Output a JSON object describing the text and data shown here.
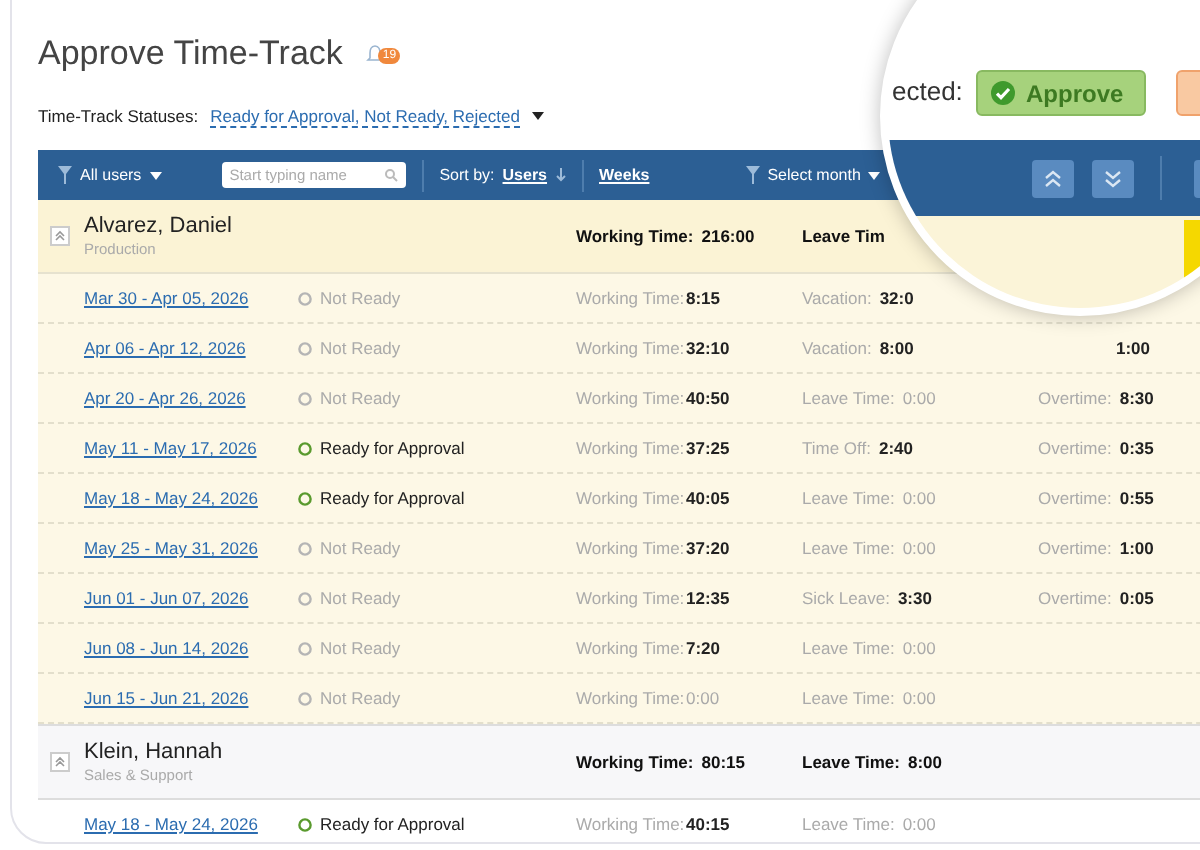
{
  "title": "Approve Time-Track",
  "notifications": {
    "count": "19"
  },
  "filter": {
    "label": "Time-Track Statuses:",
    "value": "Ready for Approval, Not Ready, Rejected"
  },
  "toolbar": {
    "users": "All users",
    "search": {
      "placeholder": "Start typing name"
    },
    "sort_label": "Sort by:",
    "sort_value": "Users",
    "period": "Weeks",
    "month": "Select month"
  },
  "magnifier": {
    "label": "ected:",
    "approve_button": "Approve"
  },
  "groups": [
    {
      "name": "Alvarez, Daniel",
      "department": "Production",
      "highlighted": true,
      "working": {
        "label": "Working Time:",
        "value": "216:00"
      },
      "leave": {
        "label": "Leave Tim"
      },
      "rows": [
        {
          "period": "Mar 30 - Apr 05, 2026",
          "status": {
            "kind": "not_ready",
            "label": "Not Ready"
          },
          "working": {
            "label": "Working Time:",
            "value": "8:15",
            "muted": false
          },
          "leave": {
            "label": "Vacation:",
            "value": "32:0",
            "muted": false
          }
        },
        {
          "period": "Apr 06 - Apr 12, 2026",
          "status": {
            "kind": "not_ready",
            "label": "Not Ready"
          },
          "working": {
            "label": "Working Time:",
            "value": "32:10",
            "muted": false
          },
          "leave": {
            "label": "Vacation:",
            "value": "8:00",
            "muted": false
          },
          "overtime": {
            "value": "1:00",
            "muted": false
          }
        },
        {
          "period": "Apr 20 - Apr 26, 2026",
          "status": {
            "kind": "not_ready",
            "label": "Not Ready"
          },
          "working": {
            "label": "Working Time:",
            "value": "40:50",
            "muted": false
          },
          "leave": {
            "label": "Leave Time:",
            "value": "0:00",
            "muted": true
          },
          "overtime": {
            "label": "Overtime:",
            "value": "8:30",
            "muted": false
          }
        },
        {
          "period": "May 11 - May 17, 2026",
          "status": {
            "kind": "ready",
            "label": "Ready for Approval"
          },
          "working": {
            "label": "Working Time:",
            "value": "37:25",
            "muted": false
          },
          "leave": {
            "label": "Time Off:",
            "value": "2:40",
            "muted": false
          },
          "overtime": {
            "label": "Overtime:",
            "value": "0:35",
            "muted": false
          }
        },
        {
          "period": "May 18 - May 24, 2026",
          "status": {
            "kind": "ready",
            "label": "Ready for Approval"
          },
          "working": {
            "label": "Working Time:",
            "value": "40:05",
            "muted": false
          },
          "leave": {
            "label": "Leave Time:",
            "value": "0:00",
            "muted": true
          },
          "overtime": {
            "label": "Overtime:",
            "value": "0:55",
            "muted": false
          }
        },
        {
          "period": "May 25 - May 31, 2026",
          "status": {
            "kind": "not_ready",
            "label": "Not Ready"
          },
          "working": {
            "label": "Working Time:",
            "value": "37:20",
            "muted": false
          },
          "leave": {
            "label": "Leave Time:",
            "value": "0:00",
            "muted": true
          },
          "overtime": {
            "label": "Overtime:",
            "value": "1:00",
            "muted": false
          }
        },
        {
          "period": "Jun 01 - Jun 07, 2026",
          "status": {
            "kind": "not_ready",
            "label": "Not Ready"
          },
          "working": {
            "label": "Working Time:",
            "value": "12:35",
            "muted": false
          },
          "leave": {
            "label": "Sick Leave:",
            "value": "3:30",
            "muted": false
          },
          "overtime": {
            "label": "Overtime:",
            "value": "0:05",
            "muted": false
          }
        },
        {
          "period": "Jun 08 - Jun 14, 2026",
          "status": {
            "kind": "not_ready",
            "label": "Not Ready"
          },
          "working": {
            "label": "Working Time:",
            "value": "7:20",
            "muted": false
          },
          "leave": {
            "label": "Leave Time:",
            "value": "0:00",
            "muted": true
          }
        },
        {
          "period": "Jun 15 - Jun 21, 2026",
          "status": {
            "kind": "not_ready",
            "label": "Not Ready"
          },
          "working": {
            "label": "Working Time:",
            "value": "0:00",
            "muted": true
          },
          "leave": {
            "label": "Leave Time:",
            "value": "0:00",
            "muted": true
          }
        }
      ]
    },
    {
      "name": "Klein, Hannah",
      "department": "Sales & Support",
      "highlighted": false,
      "working": {
        "label": "Working Time:",
        "value": "80:15"
      },
      "leave": {
        "label": "Leave Time:",
        "value": "8:00"
      },
      "rows": [
        {
          "period": "May 18 - May 24, 2026",
          "status": {
            "kind": "ready",
            "label": "Ready for Approval"
          },
          "working": {
            "label": "Working Time:",
            "value": "40:15",
            "muted": false
          },
          "leave": {
            "label": "Leave Time:",
            "value": "0:00",
            "muted": true
          }
        }
      ]
    }
  ]
}
